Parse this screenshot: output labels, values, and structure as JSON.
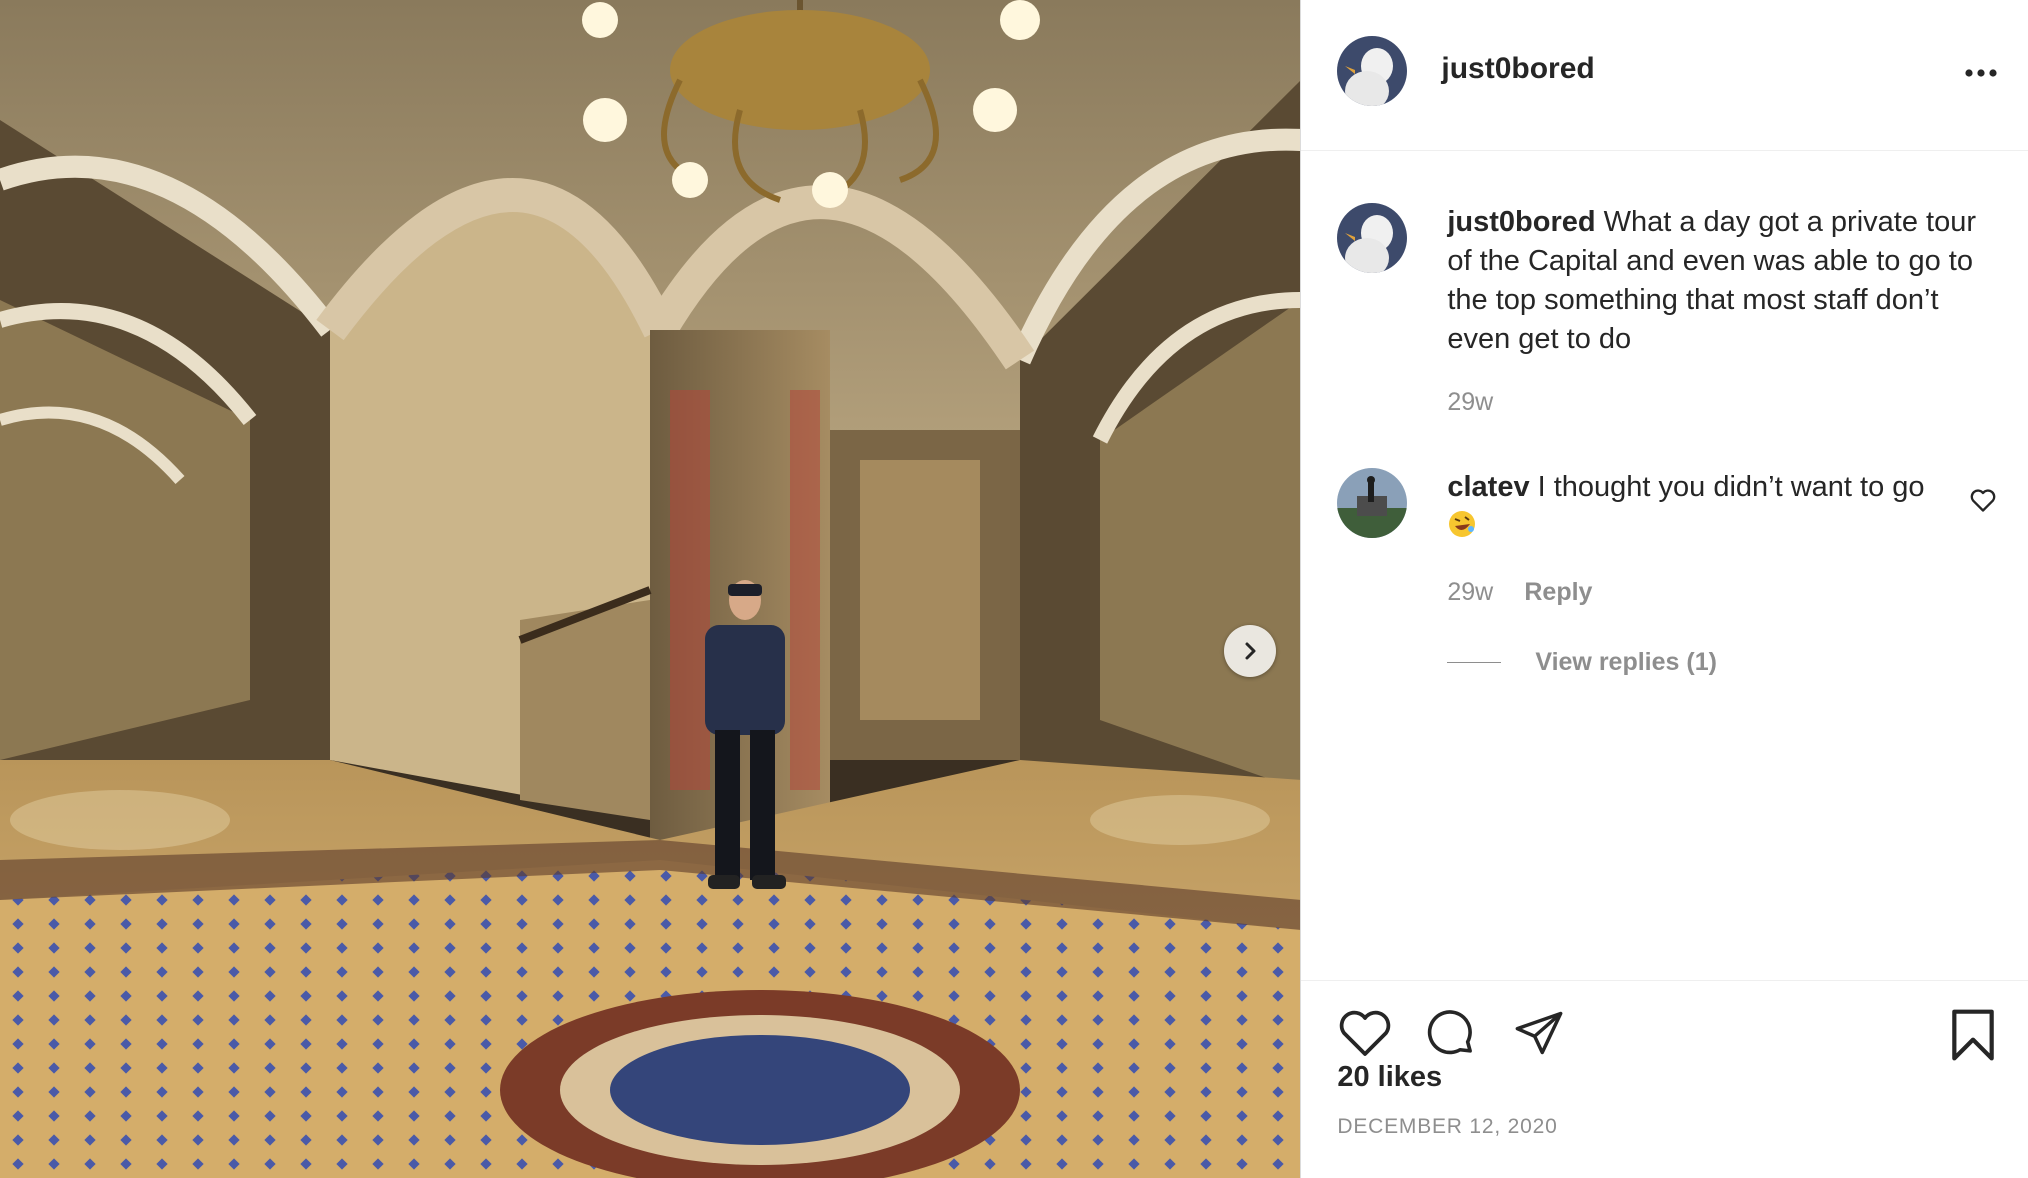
{
  "post": {
    "author": "just0bored",
    "more_icon": "more-horizontal-icon",
    "next_icon": "chevron-right-icon",
    "photo_alt": "Person standing in an ornate arched hallway with a chandelier"
  },
  "caption": {
    "username": "just0bored",
    "text": "What a day got a private tour of the Capital and even was able to go to the top something that most staff don’t even get to do",
    "time": "29w"
  },
  "comments": [
    {
      "username": "clatev",
      "text": "I thought you didn’t want to go",
      "emoji": "rolling-laughing-emoji",
      "time": "29w",
      "reply_label": "Reply",
      "view_replies_label": "View replies (1)"
    }
  ],
  "footer": {
    "likes": "20 likes",
    "date": "DECEMBER 12, 2020",
    "icons": [
      "heart-icon",
      "comment-icon",
      "share-icon",
      "bookmark-icon"
    ]
  },
  "colors": {
    "text": "#262626",
    "secondary": "#8e8e8e",
    "border": "#dbdbdb"
  }
}
